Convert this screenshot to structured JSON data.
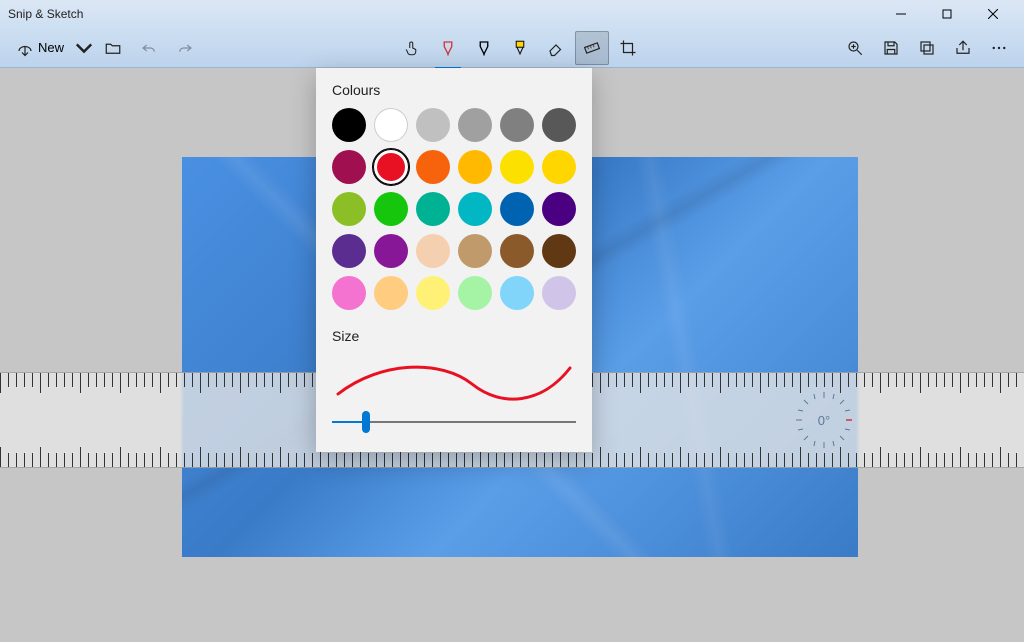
{
  "app": {
    "title": "Snip & Sketch"
  },
  "toolbar": {
    "new_label": "New"
  },
  "popup": {
    "colours_label": "Colours",
    "size_label": "Size",
    "colours": [
      "#000000",
      "#ffffff",
      "#c0c0c0",
      "#a0a0a0",
      "#808080",
      "#585858",
      "#a01050",
      "#e81123",
      "#f7630c",
      "#ffb900",
      "#fce100",
      "#ffd600",
      "#8cbf26",
      "#16c60c",
      "#00b294",
      "#00b7c3",
      "#0063b1",
      "#4b0082",
      "#5c2d91",
      "#881798",
      "#f5d0b0",
      "#c19a6b",
      "#8b5a2b",
      "#603813",
      "#f472d0",
      "#ffcc80",
      "#fff176",
      "#a5f4a5",
      "#81d4fa",
      "#d1c4e9"
    ],
    "selected_colour_index": 7,
    "stroke_colour": "#e81123",
    "size_value": 14,
    "size_min": 1,
    "size_max": 100
  },
  "ruler": {
    "angle": "0°"
  },
  "colors": {
    "accent": "#0078d4"
  }
}
